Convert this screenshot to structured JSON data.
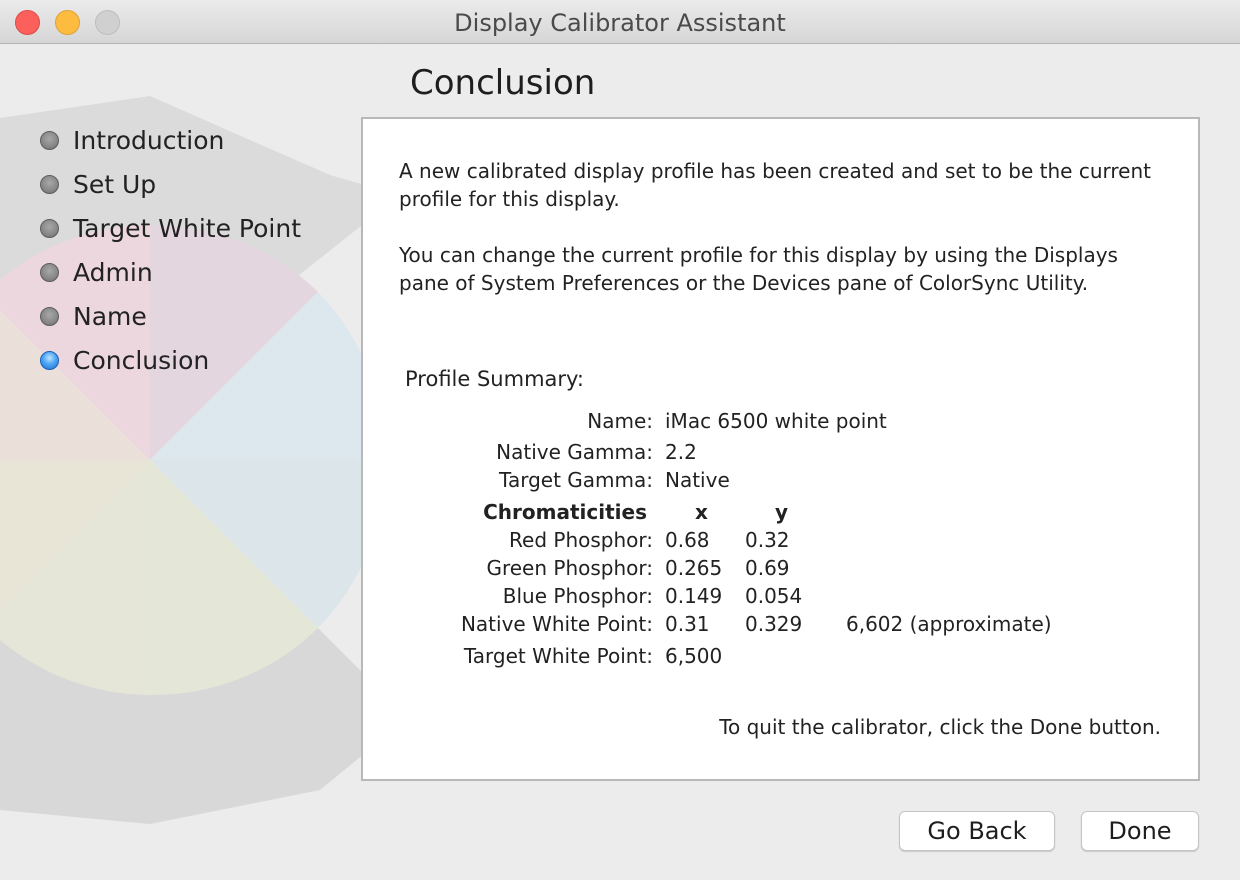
{
  "window": {
    "title": "Display Calibrator Assistant"
  },
  "page": {
    "title": "Conclusion"
  },
  "steps": [
    {
      "label": "Introduction",
      "active": false
    },
    {
      "label": "Set Up",
      "active": false
    },
    {
      "label": "Target White Point",
      "active": false
    },
    {
      "label": "Admin",
      "active": false
    },
    {
      "label": "Name",
      "active": false
    },
    {
      "label": "Conclusion",
      "active": true
    }
  ],
  "content": {
    "paragraph1": "A new calibrated display profile has been created and set to be the current profile for this display.",
    "paragraph2": "You can change the current profile for this display by using the Displays pane of System Preferences or the Devices pane of ColorSync Utility.",
    "summary_title": "Profile Summary:",
    "summary": {
      "name_label": "Name:",
      "name_value": "iMac 6500 white point",
      "native_gamma_label": "Native Gamma:",
      "native_gamma_value": "2.2",
      "target_gamma_label": "Target Gamma:",
      "target_gamma_value": "Native",
      "chromaticities_label": "Chromaticities",
      "x_header": "x",
      "y_header": "y",
      "red_label": "Red Phosphor:",
      "red_x": "0.68",
      "red_y": "0.32",
      "green_label": "Green Phosphor:",
      "green_x": "0.265",
      "green_y": "0.69",
      "blue_label": "Blue Phosphor:",
      "blue_x": "0.149",
      "blue_y": "0.054",
      "native_white_label": "Native White Point:",
      "native_white_x": "0.31",
      "native_white_y": "0.329",
      "native_white_temp": "6,602 (approximate)",
      "target_white_label": "Target White Point:",
      "target_white_value": "6,500"
    },
    "quit_note": "To quit the calibrator, click the Done button."
  },
  "buttons": {
    "go_back": "Go Back",
    "done": "Done"
  },
  "colors": {
    "close": "#fc605c",
    "minimize": "#fdbc40",
    "active_step": "#3d8ef0"
  }
}
